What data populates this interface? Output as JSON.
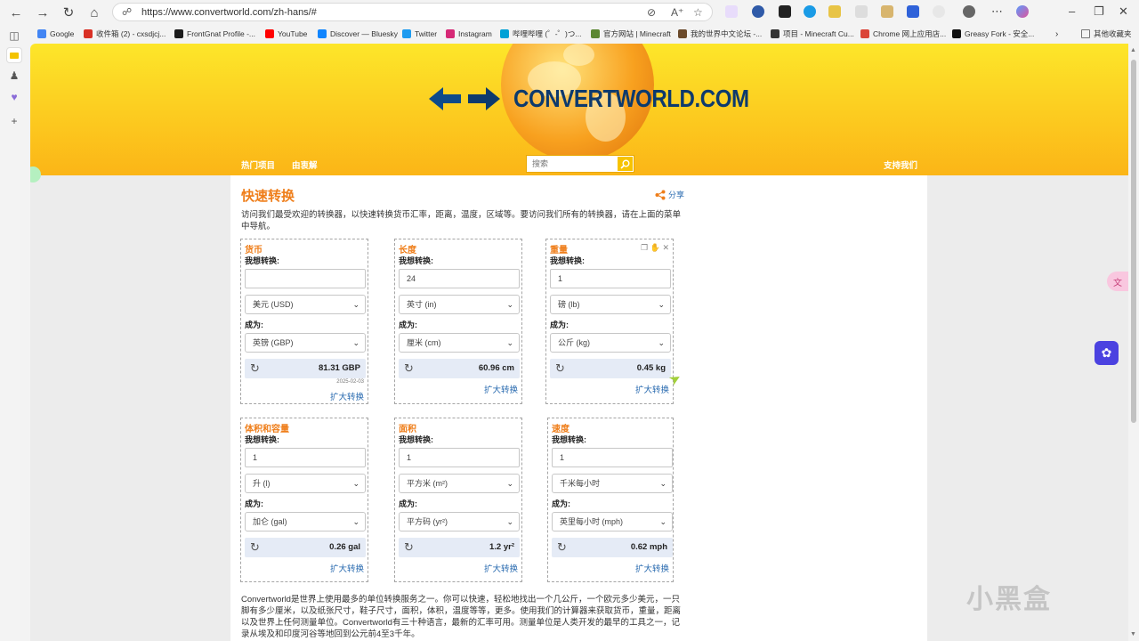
{
  "browser": {
    "url": "https://www.convertworld.com/zh-hans/#",
    "bookmarks": [
      {
        "label": "Google",
        "color": "#4285f4"
      },
      {
        "label": "收件箱 (2) - cxsdjcj...",
        "color": "#d93025"
      },
      {
        "label": "FrontGnat Profile -...",
        "color": "#1b1b1b"
      },
      {
        "label": "YouTube",
        "color": "#ff0000"
      },
      {
        "label": "Discover — Bluesky",
        "color": "#1185fe"
      },
      {
        "label": "Twitter",
        "color": "#1d9bf0"
      },
      {
        "label": "Instagram",
        "color": "#d62976"
      },
      {
        "label": "哔哩哔哩 (゜-゜)つ...",
        "color": "#00a1d6"
      },
      {
        "label": "官方网站 | Minecraft",
        "color": "#5b8731"
      },
      {
        "label": "我的世界中文论坛 -...",
        "color": "#6b4a2b"
      },
      {
        "label": "项目 - Minecraft Cu...",
        "color": "#333333"
      },
      {
        "label": "Chrome 网上应用店...",
        "color": "#db4437"
      },
      {
        "label": "Greasy Fork - 安全...",
        "color": "#111111"
      }
    ],
    "other_bookmarks": "其他收藏夹"
  },
  "site": {
    "logo": "CONVERTWORLD.COM",
    "nav": {
      "popular": "热门项目",
      "units": "由衷解",
      "support": "支持我们"
    },
    "search_placeholder": "搜索"
  },
  "main": {
    "title": "快速转换",
    "share": "分享",
    "intro": "访问我们最受欢迎的转换器，以快速转换货币汇率，距离，温度，区域等。要访问我们所有的转换器，请在上面的菜单中导航。",
    "want_label": "我想转换:",
    "to_label": "成为:",
    "expand_label": "扩大转换",
    "converters": [
      {
        "title": "货币",
        "value": "",
        "from": "美元 (USD)",
        "to": "英镑 (GBP)",
        "result": "81.31 GBP",
        "date": "2025-02-03"
      },
      {
        "title": "长度",
        "value": "24",
        "from": "英寸 (in)",
        "to": "厘米 (cm)",
        "result": "60.96 cm"
      },
      {
        "title": "重量",
        "value": "1",
        "from": "磅 (lb)",
        "to": "公斤 (kg)",
        "result": "0.45 kg"
      },
      {
        "title": "体积和容量",
        "value": "1",
        "from": "升 (l)",
        "to": "加仑 (gal)",
        "result": "0.26 gal"
      },
      {
        "title": "面积",
        "value": "1",
        "from": "平方米 (m²)",
        "to": "平方码 (yr²)",
        "result": "1.2 yr²"
      },
      {
        "title": "速度",
        "value": "1",
        "from": "千米每小时",
        "to": "英里每小时 (mph)",
        "result": "0.62 mph"
      }
    ],
    "bottom_text": "Convertworld是世界上使用最多的单位转换服务之一。你可以快速，轻松地找出一个几公斤，一个欧元多少美元，一只脚有多少厘米，以及纸张尺寸，鞋子尺寸，面积，体积，温度等等，更多。使用我们的计算器来获取货币，重量，距离以及世界上任何测量单位。Convertworld有三十种语言，最新的汇率可用。测量单位是人类开发的最早的工具之一，记录从埃及和印度河谷等地回到公元前4至3千年。"
  },
  "overlay": {
    "watermark": "小黑盒"
  }
}
